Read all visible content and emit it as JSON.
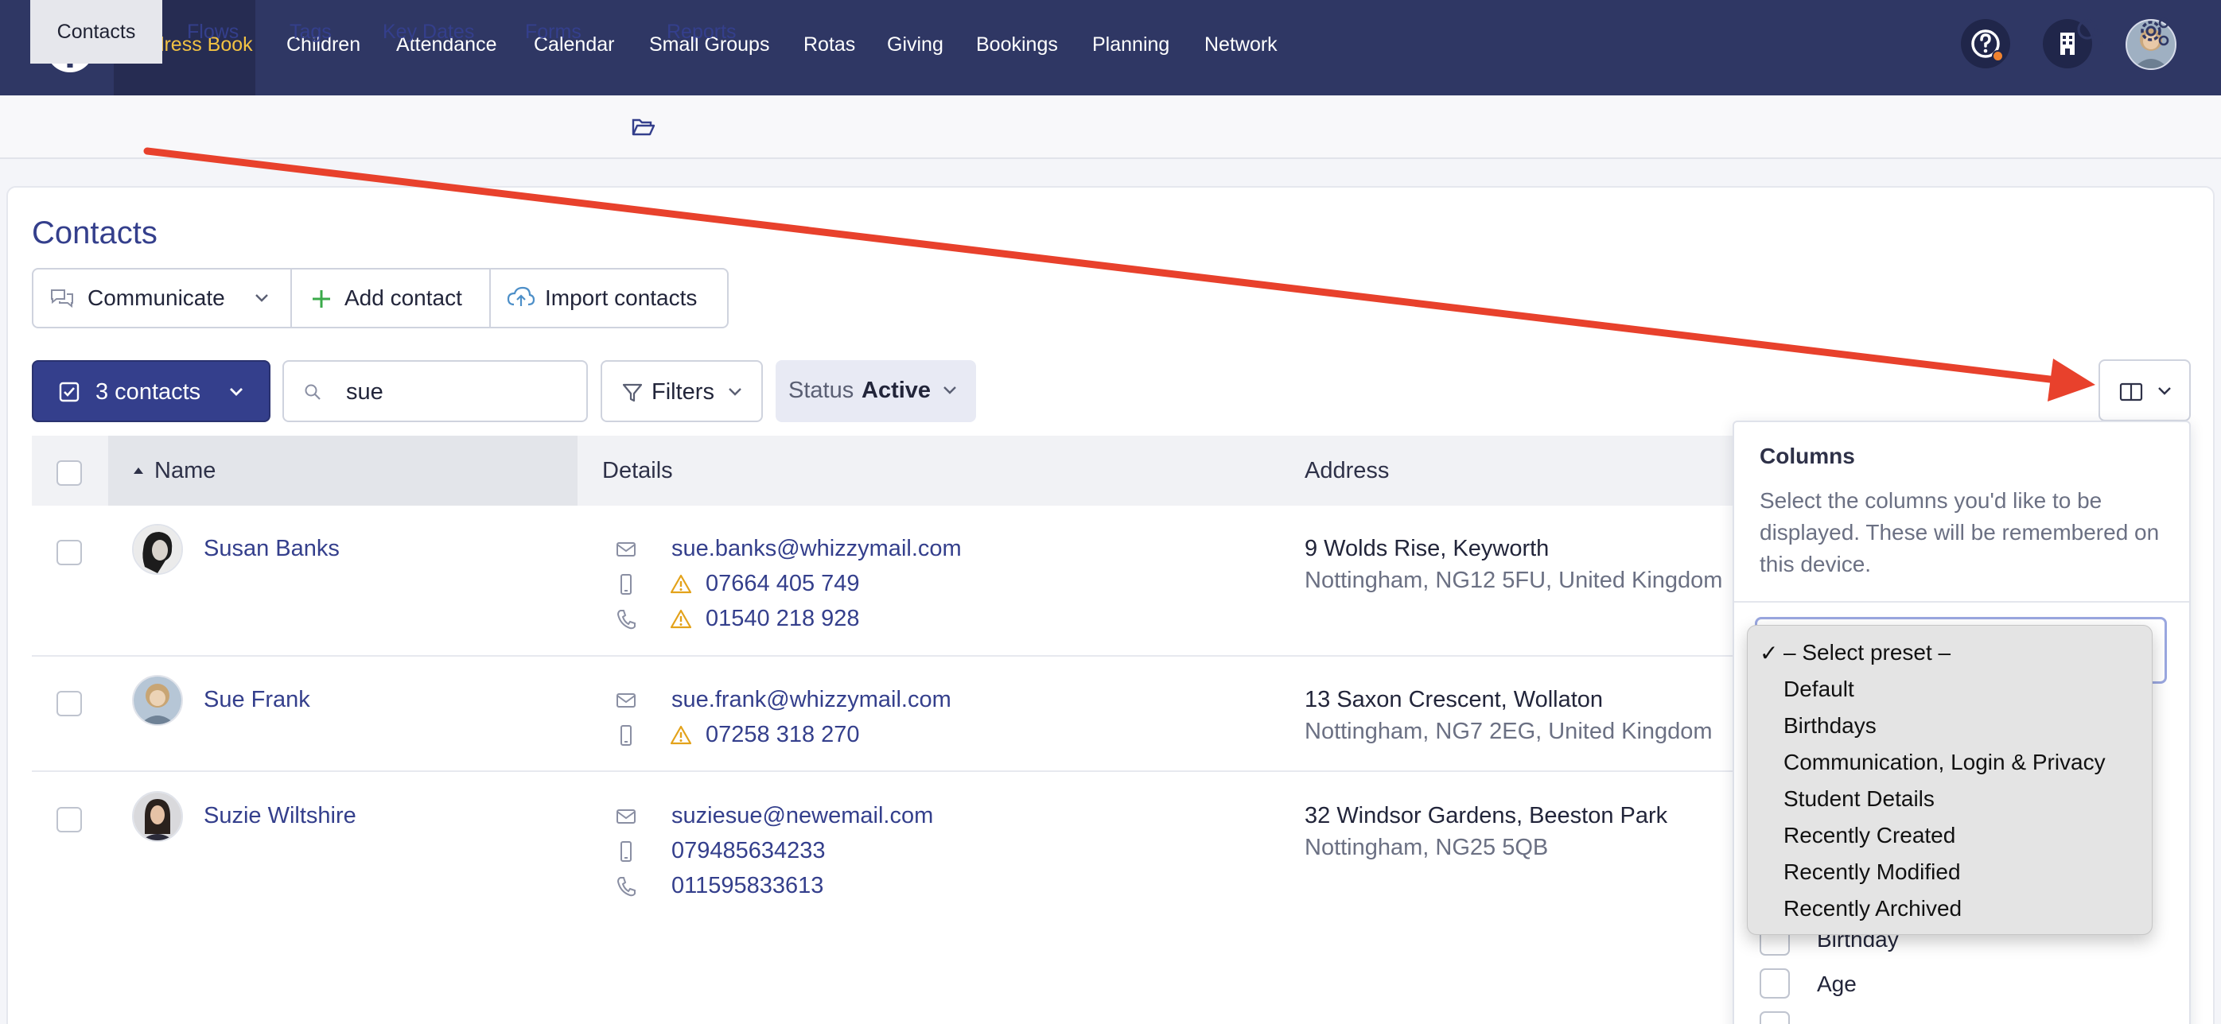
{
  "top_nav": {
    "items": [
      {
        "label": "Address Book",
        "active": true
      },
      {
        "label": "Children"
      },
      {
        "label": "Attendance"
      },
      {
        "label": "Calendar"
      },
      {
        "label": "Small Groups"
      },
      {
        "label": "Rotas"
      },
      {
        "label": "Giving"
      },
      {
        "label": "Bookings"
      },
      {
        "label": "Planning"
      },
      {
        "label": "Network"
      }
    ],
    "icons": [
      "help-icon",
      "building-icon",
      "user-avatar"
    ]
  },
  "sub_nav": {
    "items": [
      {
        "label": "Contacts",
        "active": true
      },
      {
        "label": "Flows"
      },
      {
        "label": "Tags"
      },
      {
        "label": "Key Dates"
      },
      {
        "label": "Forms"
      },
      {
        "label": "Reports",
        "icon": "folder-open-icon"
      }
    ],
    "tools": [
      "search-icon",
      "settings-gear-icon"
    ]
  },
  "page": {
    "title": "Contacts",
    "actions": {
      "communicate": "Communicate",
      "add_contact": "Add contact",
      "import_contacts": "Import contacts"
    },
    "toolbar": {
      "selected_count": "3 contacts",
      "search_value": "sue",
      "filters": "Filters",
      "status_label": "Status",
      "status_value": "Active"
    }
  },
  "table": {
    "columns": [
      "Name",
      "Details",
      "Address"
    ],
    "sort": {
      "column": "Name",
      "direction": "asc"
    },
    "rows": [
      {
        "name": "Susan Banks",
        "details": [
          {
            "type": "email",
            "value": "sue.banks@whizzymail.com",
            "warning": false
          },
          {
            "type": "mobile",
            "value": "07664 405 749",
            "warning": true
          },
          {
            "type": "phone",
            "value": "01540 218 928",
            "warning": true
          }
        ],
        "address_line1": "9 Wolds Rise, Keyworth",
        "address_line2": "Nottingham, NG12 5FU, United Kingdom"
      },
      {
        "name": "Sue Frank",
        "details": [
          {
            "type": "email",
            "value": "sue.frank@whizzymail.com",
            "warning": false
          },
          {
            "type": "mobile",
            "value": "07258 318 270",
            "warning": true
          }
        ],
        "address_line1": "13 Saxon Crescent, Wollaton",
        "address_line2": "Nottingham, NG7 2EG, United Kingdom"
      },
      {
        "name": "Suzie Wiltshire",
        "details": [
          {
            "type": "email",
            "value": "suziesue@newemail.com",
            "warning": false
          },
          {
            "type": "mobile",
            "value": "079485634233",
            "warning": false
          },
          {
            "type": "phone",
            "value": "011595833613",
            "warning": false
          }
        ],
        "address_line1": "32 Windsor Gardens, Beeston Park",
        "address_line2": "Nottingham, NG25 5QB"
      }
    ]
  },
  "columns_panel": {
    "title": "Columns",
    "description": "Select the columns you'd like to be displayed. These will be remembered on this device.",
    "preset_options": [
      "– Select preset –",
      "Default",
      "Birthdays",
      "Communication, Login & Privacy",
      "Student Details",
      "Recently Created",
      "Recently Modified",
      "Recently Archived"
    ],
    "selected_preset": "– Select preset –",
    "column_items": [
      "Birthday",
      "Age"
    ]
  },
  "colors": {
    "nav_bg": "#2f3764",
    "nav_active_text": "#f2c243",
    "primary": "#343f8c",
    "warning": "#e3a21a",
    "annotation_arrow": "#e8412c"
  }
}
